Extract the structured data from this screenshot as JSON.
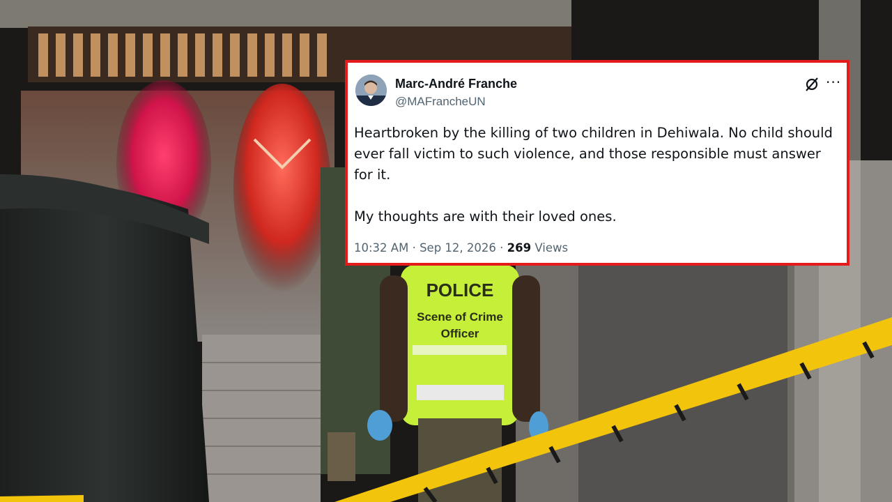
{
  "tweet": {
    "author_name": "Marc-André Franche",
    "author_handle": "@MAFrancheUN",
    "body_paragraph_1": "Heartbroken by the killing of two children in Dehiwala. No child should ever fall victim to such violence, and those responsible must answer for it.",
    "body_paragraph_2": "My thoughts are with their loved ones.",
    "time": "10:32 AM",
    "separator": "·",
    "date": "Sep 12, 2026",
    "views_count": "269",
    "views_label": "Views"
  },
  "photo": {
    "vest_line_1": "POLICE",
    "vest_line_2": "Scene of Crime",
    "vest_line_3": "Officer"
  },
  "icons": {
    "grok": "grok-icon",
    "more": "more-icon",
    "avatar": "avatar"
  },
  "colors": {
    "highlight_border": "#e51b1b",
    "vest": "#c6ef3a",
    "tape": "#f2c40c"
  }
}
